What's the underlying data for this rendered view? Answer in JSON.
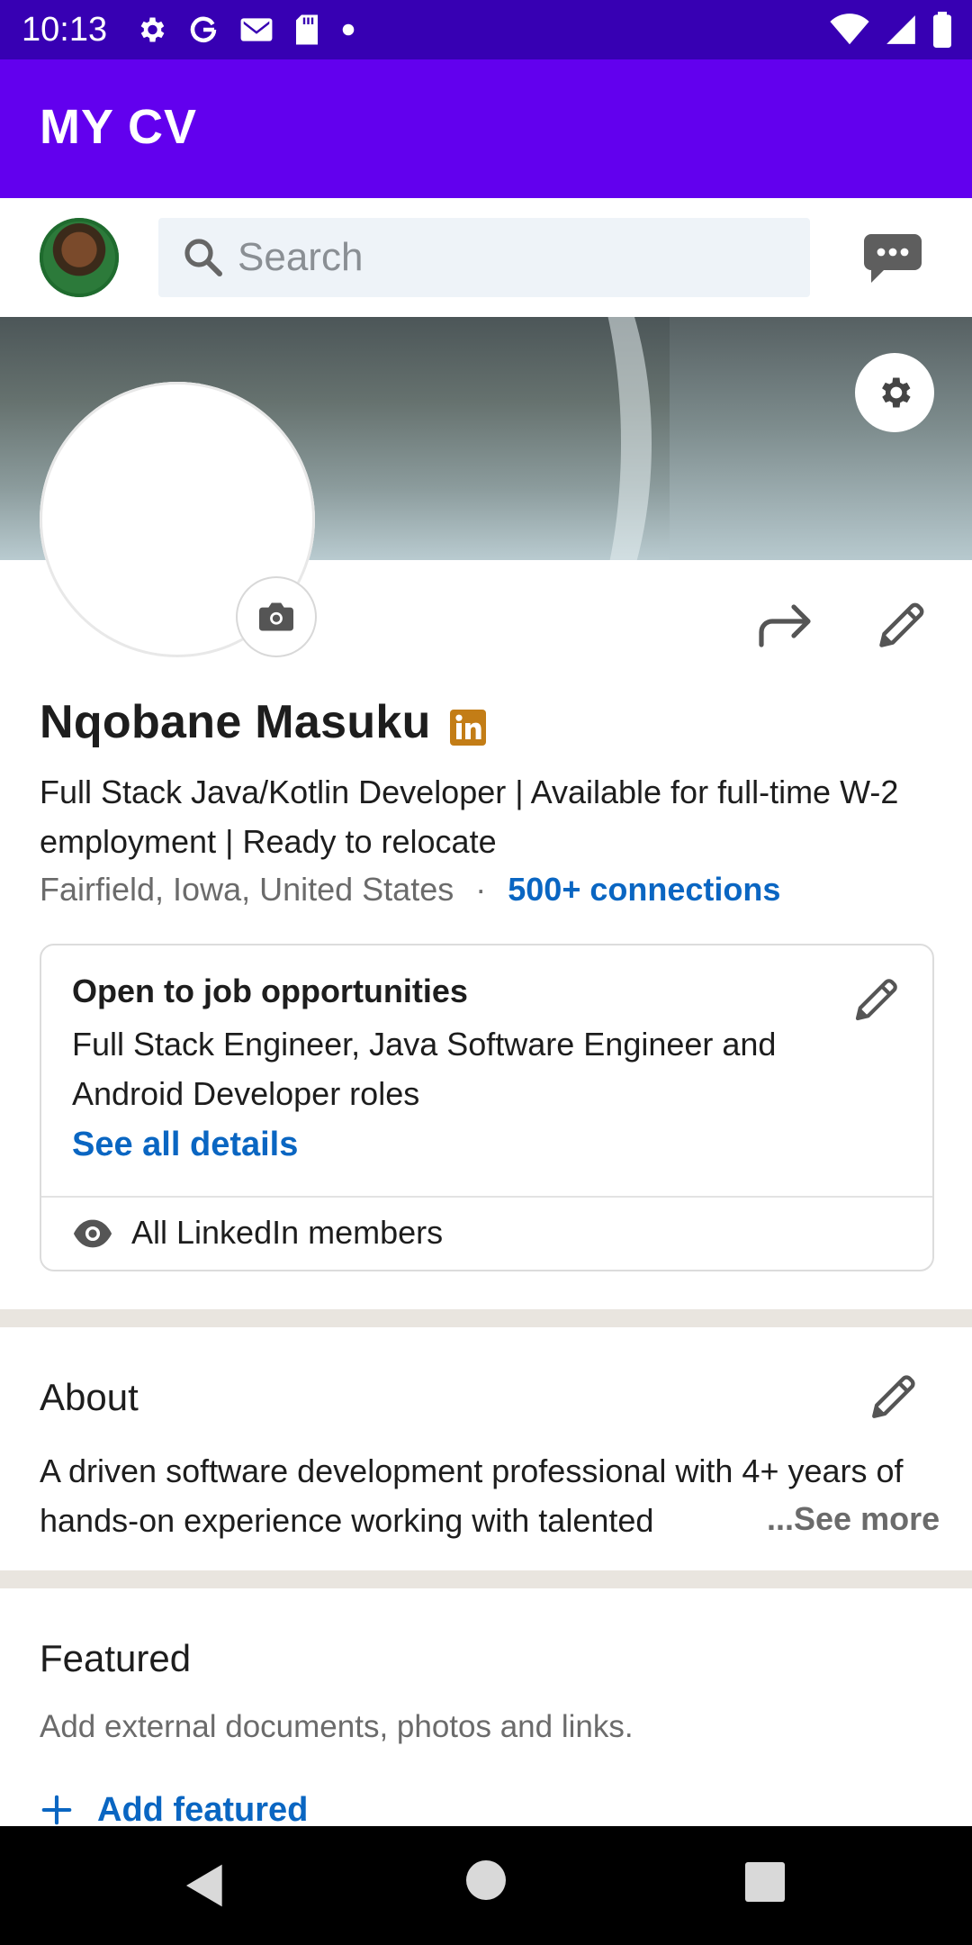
{
  "status_bar": {
    "time": "10:13",
    "left_icons": [
      "gear-icon",
      "google-icon",
      "gmail-icon",
      "sd-card-icon",
      "dot-icon"
    ],
    "right_icons": [
      "wifi-icon",
      "signal-icon",
      "battery-icon"
    ]
  },
  "app_bar": {
    "title": "MY CV"
  },
  "search": {
    "placeholder": "Search"
  },
  "profile": {
    "name": "Nqobane Masuku",
    "headline": "Full Stack Java/Kotlin Developer | Available for full-time W-2 employment | Ready to relocate",
    "location": "Fairfield, Iowa, United States",
    "separator": "·",
    "connections": "500+ connections"
  },
  "open_to_work": {
    "title": "Open to job opportunities",
    "description": "Full Stack Engineer, Java Software Engineer and Android Developer roles",
    "link": "See all details",
    "visibility": "All LinkedIn members"
  },
  "about": {
    "title": "About",
    "text": "A driven software development professional with 4+ years of hands-on experience working with talented",
    "see_more": "...See more"
  },
  "featured": {
    "title": "Featured",
    "description": "Add external documents, photos and links.",
    "add_label": "Add featured"
  },
  "colors": {
    "status_bar": "#3700b3",
    "app_bar": "#6200ee",
    "link_blue": "#0a66c2",
    "linkedin_badge": "#c37d16"
  }
}
